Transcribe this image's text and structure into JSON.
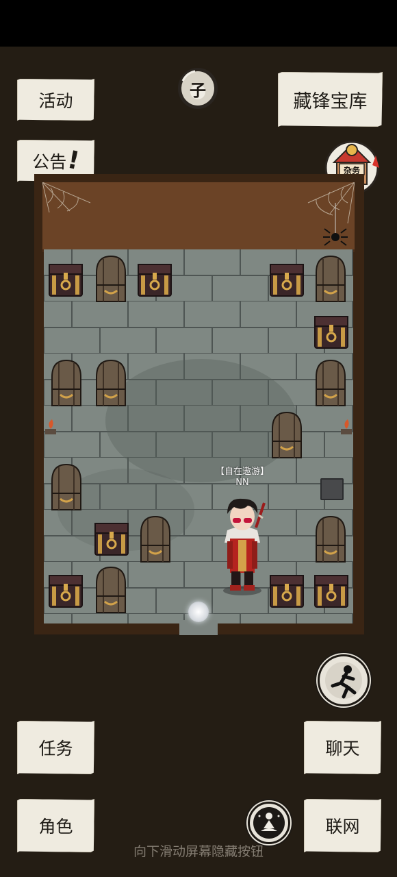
{
  "buttons": {
    "activity": "活动",
    "notice": "公告",
    "treasury": "藏锋宝库",
    "task": "任务",
    "chat": "聊天",
    "character": "角色",
    "network": "联网"
  },
  "hour_marker": "子",
  "shop_sign": "杂务",
  "player": {
    "title": "【自在遨游】",
    "name": "NN"
  },
  "hint": "向下滑动屏幕隐藏按钮",
  "colors": {
    "paper": "#efebe0",
    "wood": "#6b4326",
    "stone": "#7d8581",
    "cape_red": "#b5231f"
  }
}
